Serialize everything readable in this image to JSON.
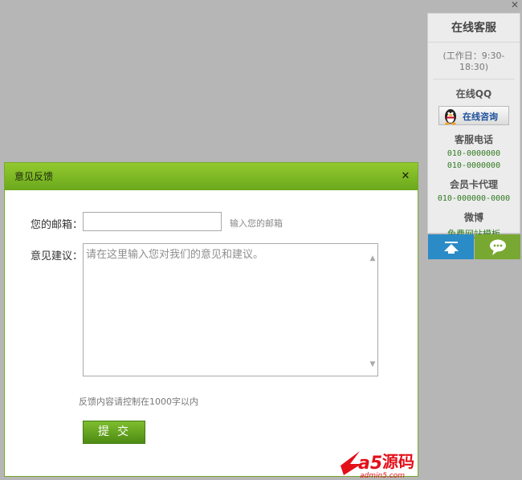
{
  "panel": {
    "close": "✕",
    "title": "在线客服",
    "hours": "(工作日：9:30-18:30)",
    "qq_heading": "在线QQ",
    "qq_button": "在线咨询",
    "phone_heading": "客服电话",
    "phones": [
      "010-0000000",
      "010-0000000"
    ],
    "card_heading": "会员卡代理",
    "card_phone": "010-000000-0000",
    "weibo_heading": "微博",
    "weibo_link": "免费网站模板"
  },
  "dialog": {
    "title": "意见反馈",
    "close": "✕",
    "email_label": "您的邮箱：",
    "email_value": "",
    "email_hint": "输入您的邮箱",
    "suggestion_label": "意见建议：",
    "suggestion_placeholder": "请在这里输入您对我们的意见和建议。",
    "limit_note": "反馈内容请控制在1000字以内",
    "submit": "提交"
  },
  "watermark": {
    "text": "a5源码",
    "url": "admin5.com"
  },
  "colors": {
    "backdrop": "#b6b6b6",
    "dialog_header": "#7fb825",
    "submit": "#5f9e1e",
    "to_top_button": "#2a8bc7",
    "chat_button": "#78a831",
    "watermark_red": "#e3101a"
  },
  "icons": {
    "panel_close": "close-icon",
    "qq": "qq-penguin-icon",
    "to_top": "arrow-up-icon",
    "chat": "chat-bubble-icon",
    "dialog_close": "close-icon"
  }
}
